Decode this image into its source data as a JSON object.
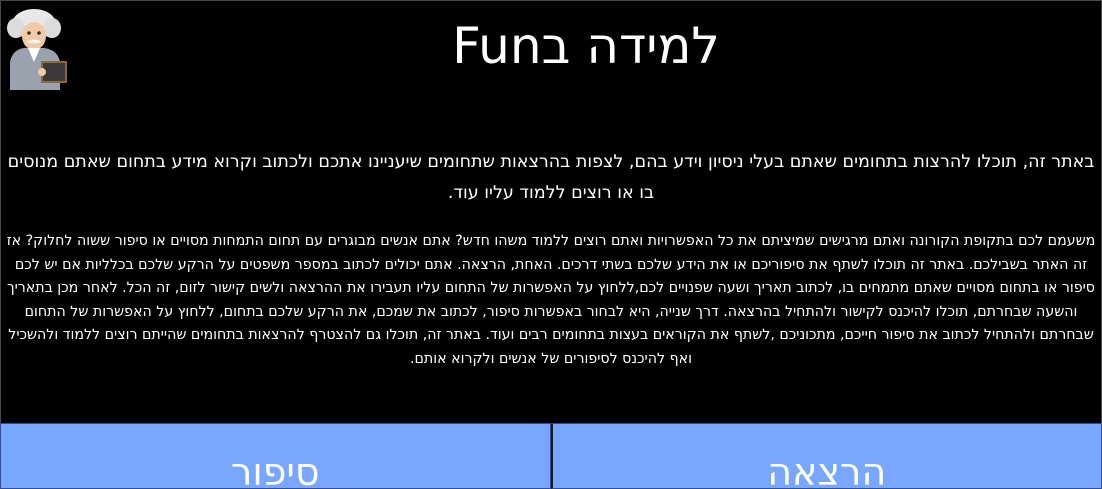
{
  "title": "למידה בFun",
  "intro": "באתר זה, תוכלו להרצות בתחומים שאתם בעלי ניסיון וידע בהם, לצפות בהרצאות שתחומים שיעניינו אתכם ולכתוב וקרוא מידע בתחום שאתם מנוסים בו או רוצים ללמוד עליו עוד.",
  "description": "משעמם לכם בתקופת הקורונה ואתם מרגישים שמיציתם את כל האפשרויות ואתם רוצים ללמוד משהו חדש? אתם אנשים מבוגרים עם תחום התמחות מסויים או סיפור ששוה לחלוק? אז זה האתר בשבילכם. באתר זה תוכלו לשתף את סיפוריכם או את הידע שלכם בשתי דרכים. האחת, הרצאה. אתם יכולים לכתוב במספר משפטים על הרקע שלכם בכלליות אם יש לכם סיפור או בתחום מסויים שאתם מתמחים בו, לכתוב תאריך ושעה שפנויים לכם,ללחוץ על האפשרות של התחום עליו תעבירו את ההרצאה ולשים קישור לזום, זה הכל. לאחר מכן בתאריך והשעה שבחרתם, תוכלו להיכנס לקישור ולהתחיל בהרצאה. דרך שנייה, היא לבחור באפשרות סיפור, לכתוב את שמכם, את הרקע שלכם בתחום, ללחוץ על האפשרות של התחום שבחרתם ולהתחיל לכתוב את סיפור חייכם, מתכוניכם ,לשתף את הקוראים בעצות בתחומים רבים ועוד. באתר זה, תוכלו גם להצטרף להרצאות בתחומים שהייתם רוצים ללמוד ולהשכיל ואף להיכנס לסיפורים של אנשים ולקרוא אותם.",
  "buttons": {
    "lecture_label": "הרצאה",
    "story_label": "סיפור"
  },
  "colors": {
    "background": "#000000",
    "button": "#79a6ff",
    "text": "#ffffff"
  },
  "icons": {
    "logo": "einstein-avatar-icon"
  }
}
